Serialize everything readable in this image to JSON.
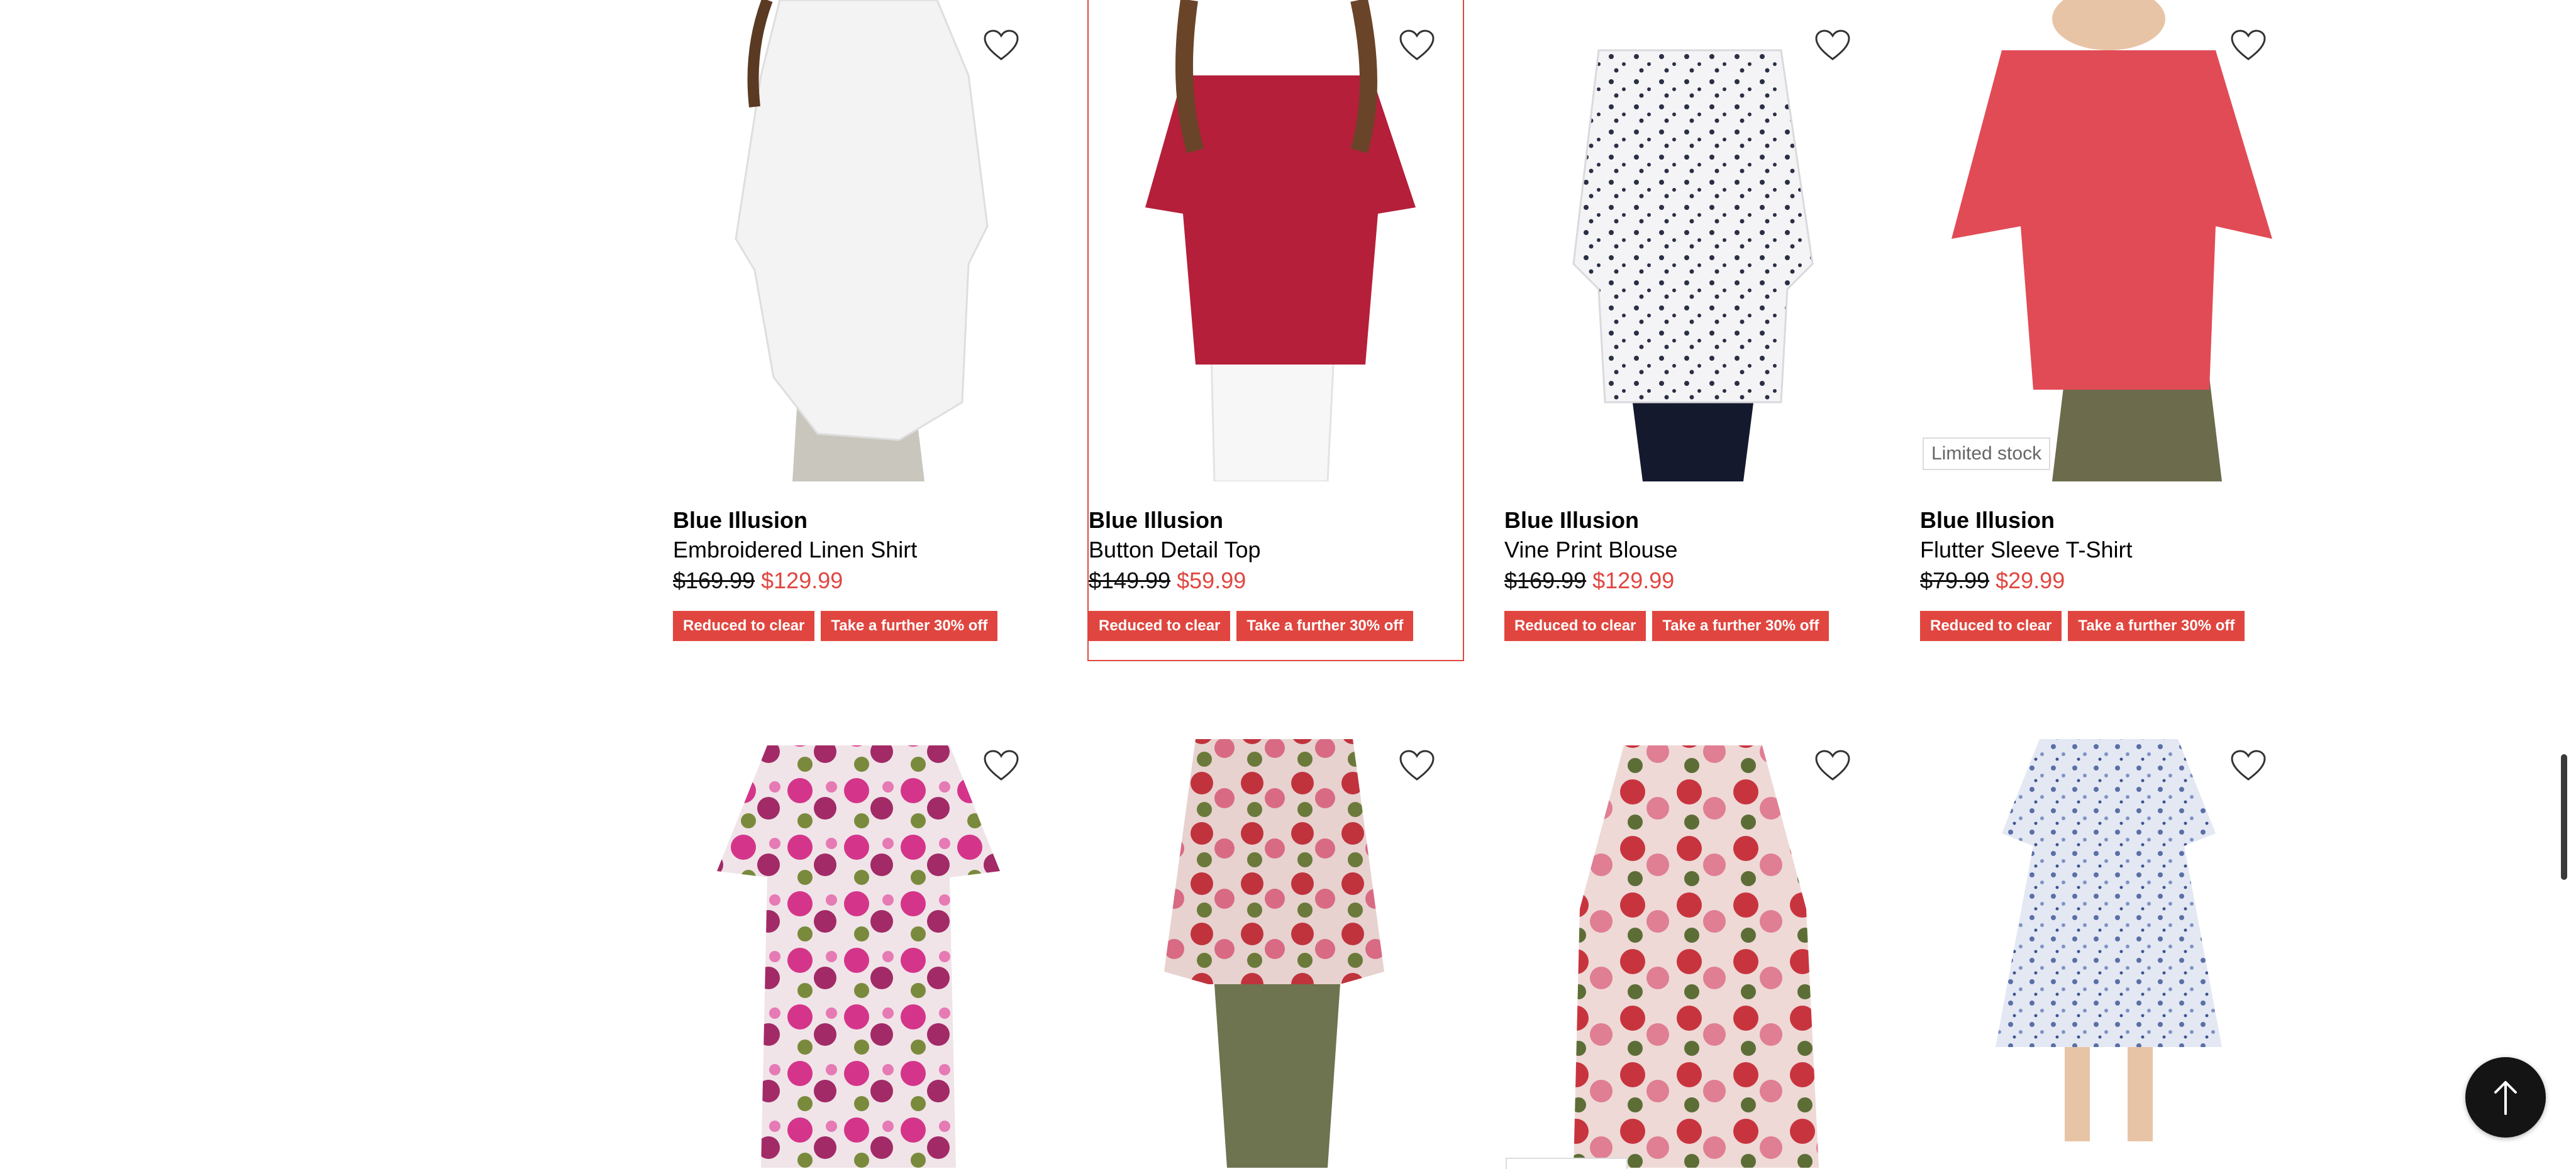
{
  "products_row1": [
    {
      "brand": "Blue Illusion",
      "name": "Embroidered Linen Shirt",
      "was": "$169.99",
      "now": "$129.99",
      "tags": [
        "Reduced to clear",
        "Take a further 30% off"
      ],
      "badge": ""
    },
    {
      "brand": "Blue Illusion",
      "name": "Button Detail Top",
      "was": "$149.99",
      "now": "$59.99",
      "tags": [
        "Reduced to clear",
        "Take a further 30% off"
      ],
      "badge": ""
    },
    {
      "brand": "Blue Illusion",
      "name": "Vine Print Blouse",
      "was": "$169.99",
      "now": "$129.99",
      "tags": [
        "Reduced to clear",
        "Take a further 30% off"
      ],
      "badge": ""
    },
    {
      "brand": "Blue Illusion",
      "name": "Flutter Sleeve T-Shirt",
      "was": "$79.99",
      "now": "$29.99",
      "tags": [
        "Reduced to clear",
        "Take a further 30% off"
      ],
      "badge": "Limited stock"
    }
  ],
  "icons": {
    "wishlist": "heart-outline-icon",
    "scroll_top": "arrow-up-icon"
  },
  "colors": {
    "sale": "#e0463f",
    "scroll_button": "#141414"
  }
}
